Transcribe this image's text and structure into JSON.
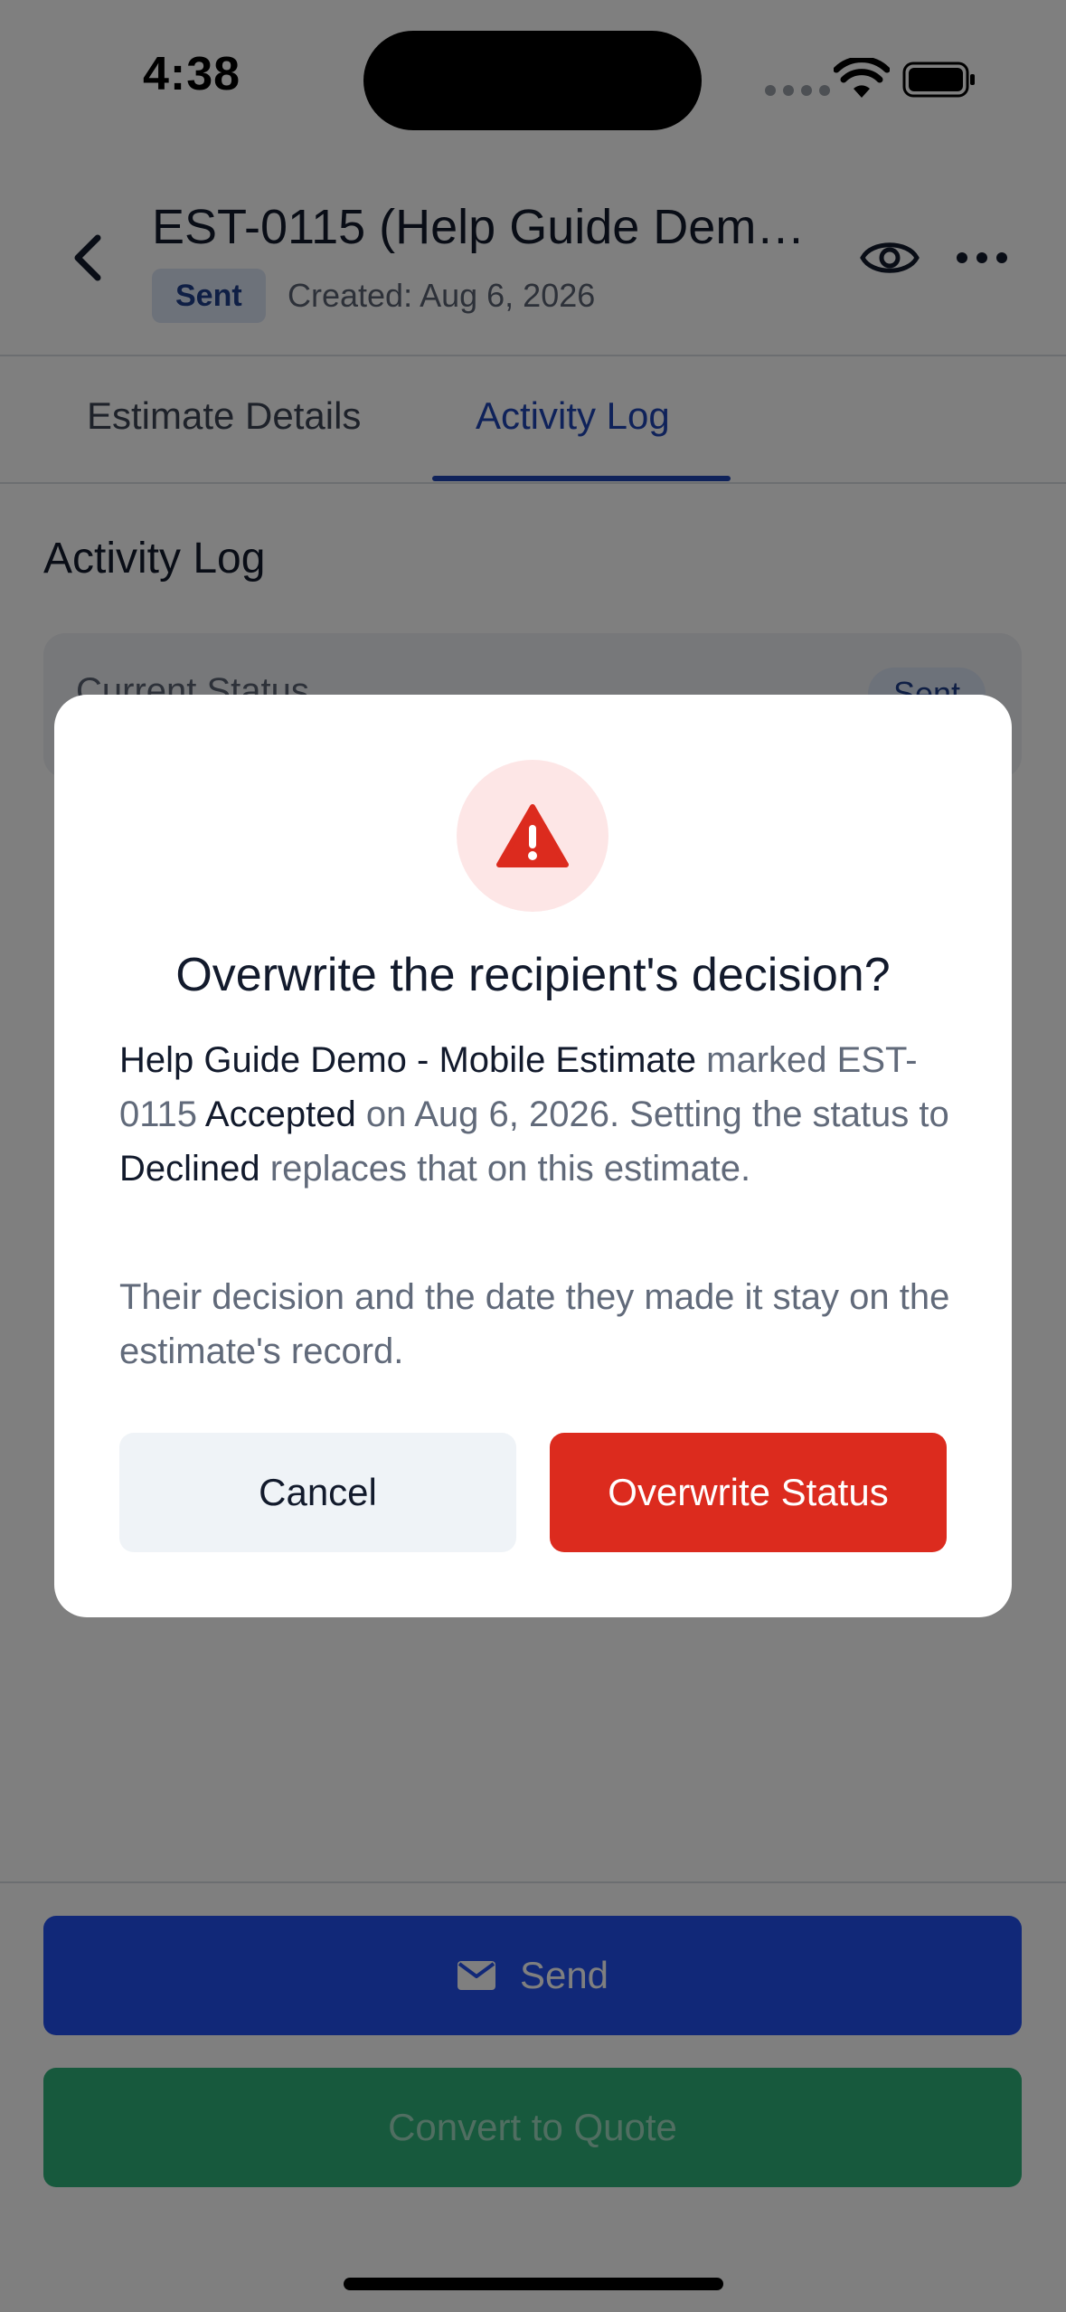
{
  "status_bar": {
    "time": "4:38"
  },
  "header": {
    "title": "EST-0115 (Help Guide Demo…",
    "status_badge": "Sent",
    "created": "Created: Aug 6, 2026"
  },
  "tabs": [
    {
      "label": "Estimate Details",
      "active": false
    },
    {
      "label": "Activity Log",
      "active": true
    }
  ],
  "content": {
    "section_title": "Activity Log",
    "current_status_label": "Current Status",
    "current_status_value": "Sent"
  },
  "actions": {
    "send_label": "Send",
    "convert_label": "Convert to Quote"
  },
  "dialog": {
    "icon": "warning-icon",
    "title": "Overwrite the recipient's decision?",
    "body": {
      "recipient": "Help Guide Demo - Mobile Estimate",
      "t1": " marked EST-0115 ",
      "accepted": "Accepted",
      "t2": " on Aug 6, 2026. Setting the status to ",
      "declined": "Declined",
      "t3": " replaces that on this estimate."
    },
    "note": "Their decision and the date they made it stay on the estimate's record.",
    "cancel_label": "Cancel",
    "confirm_label": "Overwrite Status"
  },
  "colors": {
    "primary": "#2250f0",
    "success": "#2fb37a",
    "danger": "#dc2b1e",
    "active_tab": "#1f45b5"
  }
}
